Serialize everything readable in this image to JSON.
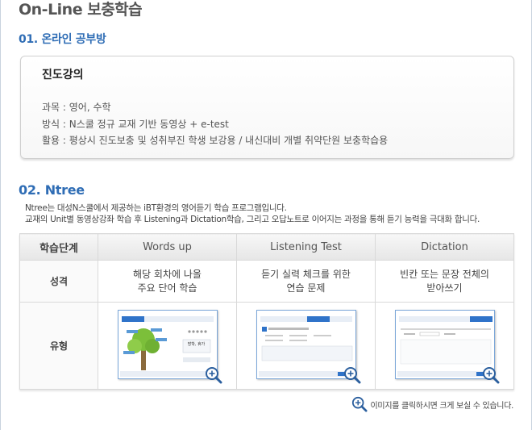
{
  "page_title": "On-Line 보충학습",
  "section1": {
    "heading": "01. 온라인 공부방",
    "card_title": "진도강의",
    "lines": [
      "과목 : 영어, 수학",
      "방식 : N스쿨 정규 교재 기반 동영상 + e-test",
      "활용 : 평상시 진도보충 및 성취부진 학생 보강용 / 내신대비 개별 취약단원 보충학습용"
    ]
  },
  "section2": {
    "heading": "02. Ntree",
    "intro": [
      "Ntree는 대성N스쿨에서 제공하는 iBT환경의 영어듣기 학습 프로그램입니다.",
      "교재의 Unit별 동영상강좌 학습 후 Listening과 Dictation학습, 그리고 오답노트로 이어지는 과정을 통해 듣기 능력을 극대화 합니다."
    ],
    "table": {
      "headers": [
        "학습단계",
        "Words up",
        "Listening Test",
        "Dictation"
      ],
      "row_nature_label": "성격",
      "nature": [
        [
          "해당 회차에 나올",
          "주요 단어 학습"
        ],
        [
          "듣기 실력 체크를 위한",
          "연습 문제"
        ],
        [
          "빈칸 또는 문장 전체의",
          "받아쓰기"
        ]
      ],
      "row_type_label": "유형",
      "thumb_text": "방학, 휴가"
    },
    "note": "이미지를 클릭하시면 크게 보실 수 있습니다."
  },
  "colors": {
    "accent": "#2f6db5",
    "thumb_blue": "#2f73c9"
  },
  "icons": {
    "zoom": "zoom-in-icon"
  }
}
